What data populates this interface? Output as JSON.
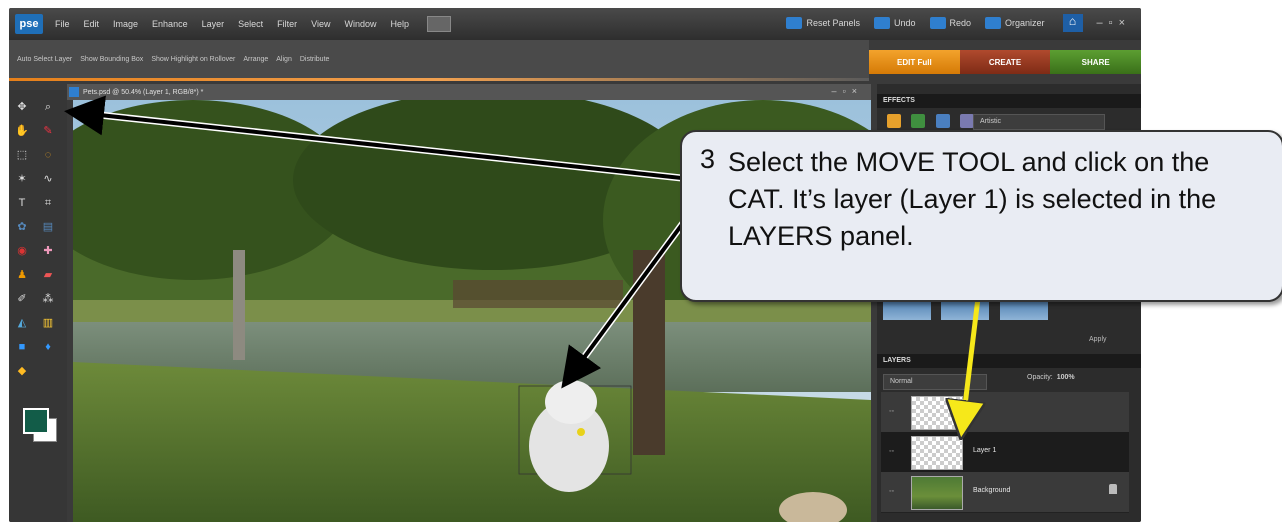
{
  "menu": {
    "logo": "pse",
    "items": [
      "File",
      "Edit",
      "Image",
      "Enhance",
      "Layer",
      "Select",
      "Filter",
      "View",
      "Window",
      "Help"
    ],
    "reset_panels": "Reset Panels",
    "undo": "Undo",
    "redo": "Redo",
    "organizer": "Organizer"
  },
  "options": {
    "auto_select": "Auto Select Layer",
    "bounding_box": "Show Bounding Box",
    "highlight": "Show Highlight on Rollover",
    "arrange": "Arrange",
    "align": "Align",
    "distribute": "Distribute"
  },
  "mode_tabs": {
    "edit": "EDIT Full",
    "create": "CREATE",
    "share": "SHARE"
  },
  "document": {
    "title": "Pets.psd @ 50.4% (Layer 1, RGB/8*) *"
  },
  "effects": {
    "header": "EFFECTS",
    "category": "Artistic",
    "apply": "Apply"
  },
  "layers": {
    "header": "LAYERS",
    "blend_mode": "Normal",
    "opacity_label": "Opacity:",
    "opacity_value": "100%",
    "rows": [
      "",
      "Layer 1",
      "Background"
    ]
  },
  "colors": {
    "foreground": "#125c48",
    "background": "#ffffff",
    "arrow_yellow": "#f6e81a"
  },
  "callout": {
    "number": "3",
    "text": "Select the MOVE TOOL and click on the CAT.  It’s layer (Layer 1) is selected in the LAYERS panel."
  }
}
